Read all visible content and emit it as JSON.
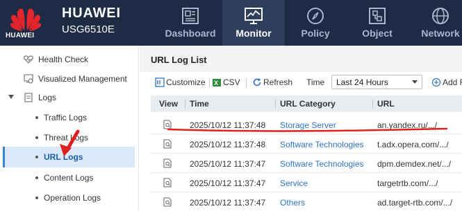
{
  "header": {
    "brand": "HUAWEI",
    "product_name": "HUAWEI",
    "product_model": "USG6510E",
    "nav_tabs": [
      {
        "label": "Dashboard",
        "icon": "dashboard-icon",
        "active": false
      },
      {
        "label": "Monitor",
        "icon": "monitor-icon",
        "active": true
      },
      {
        "label": "Policy",
        "icon": "compass-icon",
        "active": false
      },
      {
        "label": "Object",
        "icon": "object-icon",
        "active": false
      },
      {
        "label": "Network",
        "icon": "globe-icon",
        "active": false
      }
    ]
  },
  "sidebar": {
    "items": [
      {
        "label": "Health Check",
        "icon": "heartbeat-icon"
      },
      {
        "label": "Visualized Management",
        "icon": "visual-management-icon"
      },
      {
        "label": "Logs",
        "icon": "document-icon",
        "expanded": true
      },
      {
        "label": "Traffic Logs"
      },
      {
        "label": "Threat Logs"
      },
      {
        "label": "URL Logs",
        "selected": true
      },
      {
        "label": "Content Logs"
      },
      {
        "label": "Operation Logs"
      }
    ]
  },
  "main": {
    "title": "URL Log List",
    "toolbar": {
      "customize": "Customize",
      "csv": "CSV",
      "refresh": "Refresh",
      "time_label": "Time",
      "time_value": "Last 24 Hours",
      "add": "Add F"
    },
    "table": {
      "columns": [
        "View",
        "Time",
        "URL Category",
        "URL"
      ],
      "rows": [
        {
          "time": "2025/10/12 11:37:48",
          "category": "Storage Server",
          "url": "an.yandex.ru/.../"
        },
        {
          "time": "2025/10/12 11:37:48",
          "category": "Software Technologies",
          "url": "t.adx.opera.com/.../"
        },
        {
          "time": "2025/10/12 11:37:47",
          "category": "Software Technologies",
          "url": "dpm.demdex.net/.../"
        },
        {
          "time": "2025/10/12 11:37:47",
          "category": "Service",
          "url": "targetrtb.com/.../"
        },
        {
          "time": "2025/10/12 11:37:47",
          "category": "Others",
          "url": "ad.target-rtb.com/.../"
        }
      ]
    }
  },
  "colors": {
    "header_bg": "#1d2b45",
    "active_tab_bg": "#2e3e5d",
    "brand_red": "#e4252b",
    "link_blue": "#2e73c7",
    "selected_bg": "#dbe8f7",
    "annotation_red": "#e02020"
  }
}
